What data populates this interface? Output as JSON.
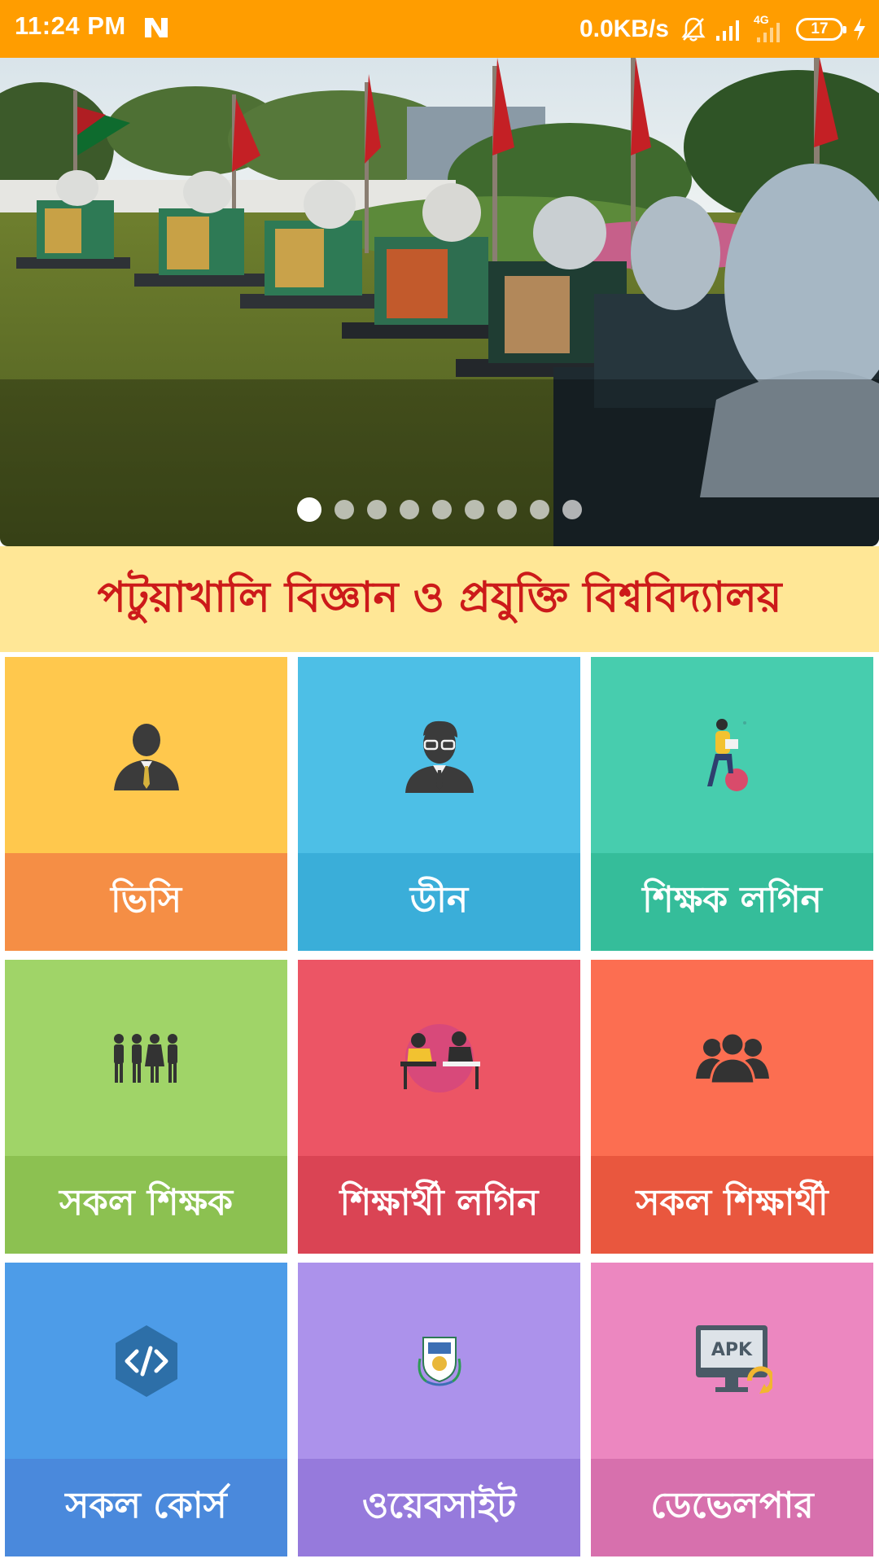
{
  "status_bar": {
    "time": "11:24 PM",
    "network_speed": "0.0KB/s",
    "network_type": "4G",
    "battery_level": "17"
  },
  "banner": {
    "slide_count": 9,
    "active_index": 0
  },
  "title": "পটুয়াখালি বিজ্ঞান ও প্রযুক্তি বিশ্ববিদ্যালয়",
  "tiles": [
    {
      "label": "ভিসি",
      "top_color": "#FFC84D",
      "bottom_color": "#F58E45",
      "icon": "vc-person-icon"
    },
    {
      "label": "ডীন",
      "top_color": "#4DBFE6",
      "bottom_color": "#3AAED9",
      "icon": "dean-person-icon"
    },
    {
      "label": "শিক্ষক লগিন",
      "top_color": "#47CDAE",
      "bottom_color": "#35BD9A",
      "icon": "teacher-reading-icon"
    },
    {
      "label": "সকল শিক্ষক",
      "top_color": "#A0D468",
      "bottom_color": "#8CC151",
      "icon": "all-teachers-icon"
    },
    {
      "label": "শিক্ষার্থী লগিন",
      "top_color": "#EC5565",
      "bottom_color": "#DA4454",
      "icon": "students-desk-icon"
    },
    {
      "label": "সকল শিক্ষার্থী",
      "top_color": "#FC6E51",
      "bottom_color": "#E9573E",
      "icon": "all-students-icon"
    },
    {
      "label": "সকল কোর্স",
      "top_color": "#4D9CE8",
      "bottom_color": "#4A89DC",
      "icon": "code-icon"
    },
    {
      "label": "ওয়েবসাইট",
      "top_color": "#AC92EB",
      "bottom_color": "#967ADC",
      "icon": "university-logo-icon"
    },
    {
      "label": "ডেভেলপার",
      "top_color": "#EC87C0",
      "bottom_color": "#D770AD",
      "icon": "apk-monitor-icon"
    }
  ]
}
